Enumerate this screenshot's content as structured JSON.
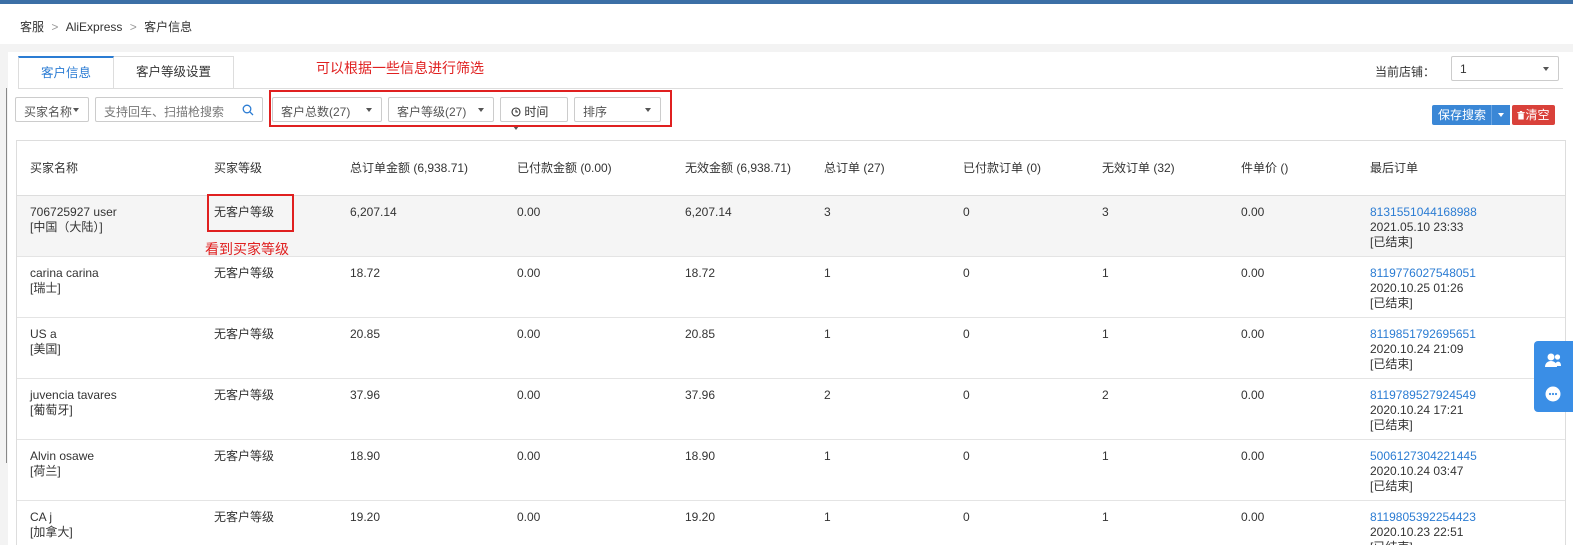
{
  "breadcrumb": {
    "items": [
      "客服",
      "AliExpress",
      "客户信息"
    ],
    "separator": ">"
  },
  "tabs": [
    {
      "label": "客户信息",
      "active": true
    },
    {
      "label": "客户等级设置",
      "active": false
    }
  ],
  "annotations": {
    "filter_note": "可以根据一些信息进行筛选",
    "level_note": "看到买家等级"
  },
  "store": {
    "label": "当前店铺：",
    "value": "1"
  },
  "filters": {
    "buyer_name": "买家名称",
    "search_placeholder": "支持回车、扫描枪搜索",
    "total_customers": "客户总数(27)",
    "customer_level": "客户等级(27)",
    "time": "时间",
    "sort": "排序"
  },
  "buttons": {
    "save_search": "保存搜索",
    "clear": "清空"
  },
  "table": {
    "headers": [
      "买家名称",
      "买家等级",
      "总订单金额 (6,938.71)",
      "已付款金额 (0.00)",
      "无效金额 (6,938.71)",
      "总订单 (27)",
      "已付款订单 (0)",
      "无效订单 (32)",
      "件单价 ()",
      "最后订单"
    ],
    "rows": [
      {
        "name": "706725927 user",
        "country": "[中国（大陆）]",
        "level": "无客户等级",
        "total": "6,207.14",
        "paid": "0.00",
        "invalid": "6,207.14",
        "orders": "3",
        "paid_orders": "0",
        "invalid_orders": "3",
        "unit": "0.00",
        "order_no": "8131551044168988",
        "order_time": "2021.05.10 23:33",
        "status": "[已结束]"
      },
      {
        "name": "carina carina",
        "country": "[瑞士]",
        "level": "无客户等级",
        "total": "18.72",
        "paid": "0.00",
        "invalid": "18.72",
        "orders": "1",
        "paid_orders": "0",
        "invalid_orders": "1",
        "unit": "0.00",
        "order_no": "8119776027548051",
        "order_time": "2020.10.25 01:26",
        "status": "[已结束]"
      },
      {
        "name": "US a",
        "country": "[美国]",
        "level": "无客户等级",
        "total": "20.85",
        "paid": "0.00",
        "invalid": "20.85",
        "orders": "1",
        "paid_orders": "0",
        "invalid_orders": "1",
        "unit": "0.00",
        "order_no": "8119851792695651",
        "order_time": "2020.10.24 21:09",
        "status": "[已结束]"
      },
      {
        "name": "juvencia tavares",
        "country": "[葡萄牙]",
        "level": "无客户等级",
        "total": "37.96",
        "paid": "0.00",
        "invalid": "37.96",
        "orders": "2",
        "paid_orders": "0",
        "invalid_orders": "2",
        "unit": "0.00",
        "order_no": "8119789527924549",
        "order_time": "2020.10.24 17:21",
        "status": "[已结束]"
      },
      {
        "name": "Alvin osawe",
        "country": "[荷兰]",
        "level": "无客户等级",
        "total": "18.90",
        "paid": "0.00",
        "invalid": "18.90",
        "orders": "1",
        "paid_orders": "0",
        "invalid_orders": "1",
        "unit": "0.00",
        "order_no": "5006127304221445",
        "order_time": "2020.10.24 03:47",
        "status": "[已结束]"
      },
      {
        "name": "CA j",
        "country": "[加拿大]",
        "level": "无客户等级",
        "total": "19.20",
        "paid": "0.00",
        "invalid": "19.20",
        "orders": "1",
        "paid_orders": "0",
        "invalid_orders": "1",
        "unit": "0.00",
        "order_no": "8119805392254423",
        "order_time": "2020.10.23 22:51",
        "status": "[已结束]"
      }
    ]
  },
  "colors": {
    "accent": "#2b7cd3",
    "annotation": "#e02020",
    "clear_button": "#d9413a"
  }
}
